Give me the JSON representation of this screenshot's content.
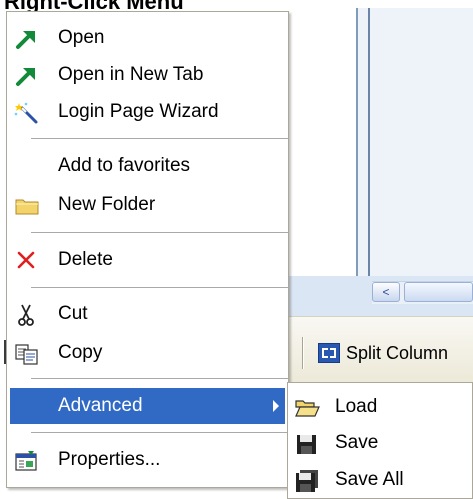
{
  "heading": "Right-Click Menu",
  "background": {
    "split_button_label": "Split Column",
    "scroll_left_arrow": "<"
  },
  "context_menu": {
    "items": [
      {
        "label": "Open",
        "icon": "green-arrow-icon"
      },
      {
        "label": "Open in New Tab",
        "icon": "green-arrow-icon"
      },
      {
        "label": "Login Page Wizard",
        "icon": "magic-wand-icon"
      },
      {
        "label": "Add to favorites",
        "icon": ""
      },
      {
        "label": "New Folder",
        "icon": "folder-icon"
      },
      {
        "label": "Delete",
        "icon": "red-x-icon"
      },
      {
        "label": "Cut",
        "icon": "scissors-icon"
      },
      {
        "label": "Copy",
        "icon": "copy-icon"
      },
      {
        "label": "Advanced",
        "icon": "",
        "selected": true
      },
      {
        "label": "Properties...",
        "icon": "properties-icon"
      }
    ]
  },
  "submenu": {
    "items": [
      {
        "label": "Load",
        "icon": "open-folder-icon"
      },
      {
        "label": "Save",
        "icon": "floppy-disk-icon"
      },
      {
        "label": "Save All",
        "icon": "floppy-disk-stack-icon"
      }
    ]
  },
  "colors": {
    "selection": "#316ac5",
    "menu_border": "#aca899",
    "delete_red": "#e02020",
    "arrow_green": "#128a3a"
  }
}
